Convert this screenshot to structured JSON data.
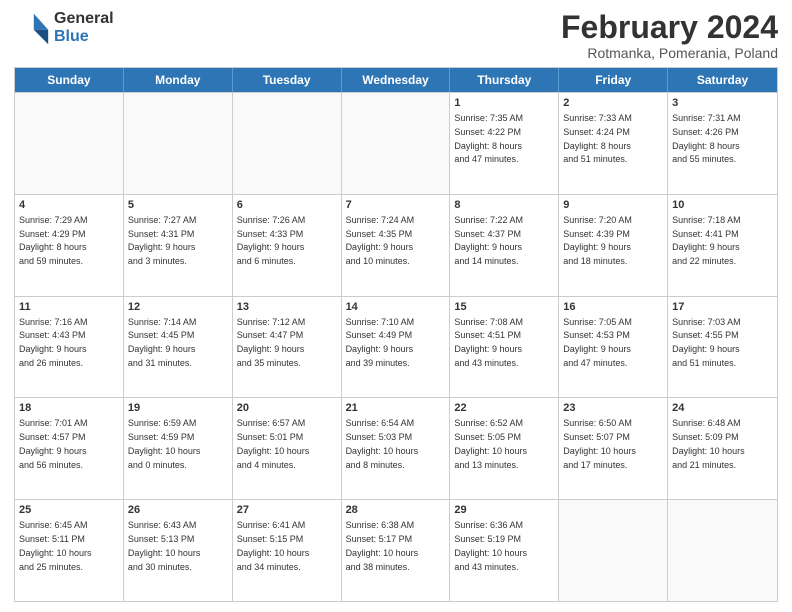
{
  "header": {
    "logo_line1": "General",
    "logo_line2": "Blue",
    "title": "February 2024",
    "subtitle": "Rotmanka, Pomerania, Poland"
  },
  "weekdays": [
    "Sunday",
    "Monday",
    "Tuesday",
    "Wednesday",
    "Thursday",
    "Friday",
    "Saturday"
  ],
  "weeks": [
    [
      {
        "day": "",
        "info": ""
      },
      {
        "day": "",
        "info": ""
      },
      {
        "day": "",
        "info": ""
      },
      {
        "day": "",
        "info": ""
      },
      {
        "day": "1",
        "info": "Sunrise: 7:35 AM\nSunset: 4:22 PM\nDaylight: 8 hours\nand 47 minutes."
      },
      {
        "day": "2",
        "info": "Sunrise: 7:33 AM\nSunset: 4:24 PM\nDaylight: 8 hours\nand 51 minutes."
      },
      {
        "day": "3",
        "info": "Sunrise: 7:31 AM\nSunset: 4:26 PM\nDaylight: 8 hours\nand 55 minutes."
      }
    ],
    [
      {
        "day": "4",
        "info": "Sunrise: 7:29 AM\nSunset: 4:29 PM\nDaylight: 8 hours\nand 59 minutes."
      },
      {
        "day": "5",
        "info": "Sunrise: 7:27 AM\nSunset: 4:31 PM\nDaylight: 9 hours\nand 3 minutes."
      },
      {
        "day": "6",
        "info": "Sunrise: 7:26 AM\nSunset: 4:33 PM\nDaylight: 9 hours\nand 6 minutes."
      },
      {
        "day": "7",
        "info": "Sunrise: 7:24 AM\nSunset: 4:35 PM\nDaylight: 9 hours\nand 10 minutes."
      },
      {
        "day": "8",
        "info": "Sunrise: 7:22 AM\nSunset: 4:37 PM\nDaylight: 9 hours\nand 14 minutes."
      },
      {
        "day": "9",
        "info": "Sunrise: 7:20 AM\nSunset: 4:39 PM\nDaylight: 9 hours\nand 18 minutes."
      },
      {
        "day": "10",
        "info": "Sunrise: 7:18 AM\nSunset: 4:41 PM\nDaylight: 9 hours\nand 22 minutes."
      }
    ],
    [
      {
        "day": "11",
        "info": "Sunrise: 7:16 AM\nSunset: 4:43 PM\nDaylight: 9 hours\nand 26 minutes."
      },
      {
        "day": "12",
        "info": "Sunrise: 7:14 AM\nSunset: 4:45 PM\nDaylight: 9 hours\nand 31 minutes."
      },
      {
        "day": "13",
        "info": "Sunrise: 7:12 AM\nSunset: 4:47 PM\nDaylight: 9 hours\nand 35 minutes."
      },
      {
        "day": "14",
        "info": "Sunrise: 7:10 AM\nSunset: 4:49 PM\nDaylight: 9 hours\nand 39 minutes."
      },
      {
        "day": "15",
        "info": "Sunrise: 7:08 AM\nSunset: 4:51 PM\nDaylight: 9 hours\nand 43 minutes."
      },
      {
        "day": "16",
        "info": "Sunrise: 7:05 AM\nSunset: 4:53 PM\nDaylight: 9 hours\nand 47 minutes."
      },
      {
        "day": "17",
        "info": "Sunrise: 7:03 AM\nSunset: 4:55 PM\nDaylight: 9 hours\nand 51 minutes."
      }
    ],
    [
      {
        "day": "18",
        "info": "Sunrise: 7:01 AM\nSunset: 4:57 PM\nDaylight: 9 hours\nand 56 minutes."
      },
      {
        "day": "19",
        "info": "Sunrise: 6:59 AM\nSunset: 4:59 PM\nDaylight: 10 hours\nand 0 minutes."
      },
      {
        "day": "20",
        "info": "Sunrise: 6:57 AM\nSunset: 5:01 PM\nDaylight: 10 hours\nand 4 minutes."
      },
      {
        "day": "21",
        "info": "Sunrise: 6:54 AM\nSunset: 5:03 PM\nDaylight: 10 hours\nand 8 minutes."
      },
      {
        "day": "22",
        "info": "Sunrise: 6:52 AM\nSunset: 5:05 PM\nDaylight: 10 hours\nand 13 minutes."
      },
      {
        "day": "23",
        "info": "Sunrise: 6:50 AM\nSunset: 5:07 PM\nDaylight: 10 hours\nand 17 minutes."
      },
      {
        "day": "24",
        "info": "Sunrise: 6:48 AM\nSunset: 5:09 PM\nDaylight: 10 hours\nand 21 minutes."
      }
    ],
    [
      {
        "day": "25",
        "info": "Sunrise: 6:45 AM\nSunset: 5:11 PM\nDaylight: 10 hours\nand 25 minutes."
      },
      {
        "day": "26",
        "info": "Sunrise: 6:43 AM\nSunset: 5:13 PM\nDaylight: 10 hours\nand 30 minutes."
      },
      {
        "day": "27",
        "info": "Sunrise: 6:41 AM\nSunset: 5:15 PM\nDaylight: 10 hours\nand 34 minutes."
      },
      {
        "day": "28",
        "info": "Sunrise: 6:38 AM\nSunset: 5:17 PM\nDaylight: 10 hours\nand 38 minutes."
      },
      {
        "day": "29",
        "info": "Sunrise: 6:36 AM\nSunset: 5:19 PM\nDaylight: 10 hours\nand 43 minutes."
      },
      {
        "day": "",
        "info": ""
      },
      {
        "day": "",
        "info": ""
      }
    ]
  ]
}
